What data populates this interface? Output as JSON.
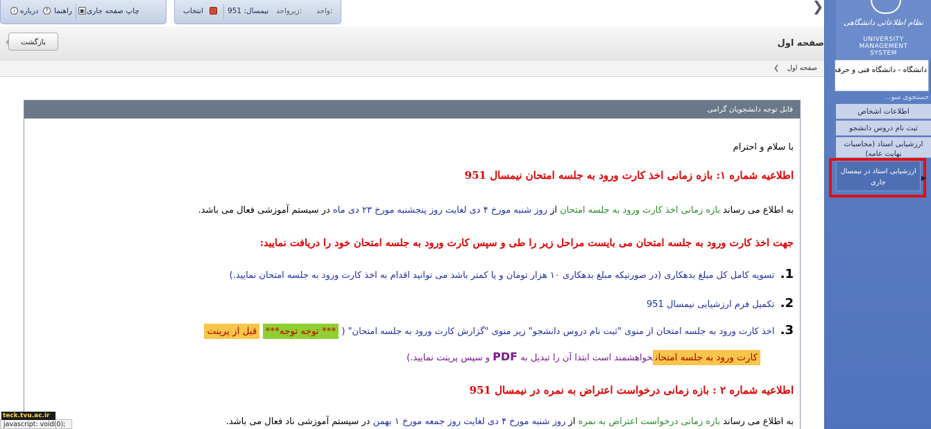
{
  "toolbar": {
    "about": "درباره",
    "help": "راهنما",
    "print_page": "چاپ صفحه جاری",
    "select": "انتخاب",
    "term": "نیمسال: 951",
    "subunit": "زیرواحد:",
    "unit": "واحد:"
  },
  "header": {
    "back": "بازگشت",
    "title": "صفحه اول"
  },
  "breadcrumb": {
    "current": "صفحه اول"
  },
  "sidebar": {
    "logo_fa": "نظام اطلاعاتی دانشگاهی",
    "logo_en_line1": "UNIVERSITY",
    "logo_en_line2": "MANAGEMENT",
    "logo_en_line3": "SYSTEM",
    "university": "دانشگاه - دانشگاه فنی و حرفه‌ای",
    "search_placeholder": "جستجوی منو...",
    "items": [
      {
        "label": "اطلاعات اشخاص"
      },
      {
        "label": "ثبت نام دروس دانشجو"
      },
      {
        "label": "ارزشیابی استاد (محاسبات نهایت عامه)"
      }
    ],
    "subitem": "ارزشیابی استاد در نیمسال جاری"
  },
  "notice": {
    "header": "قابل توجه دانشجویان گرامی",
    "greeting": "با سلام و احترام",
    "n1_title": "اطلاعیه شماره ۱: بازه زمانی اخذ کارت ورود به جلسه امتحان نیمسال 951",
    "n1_body_a": "به اطلاع می رساند ",
    "n1_body_b": "بازه زمانی اخذ کارت ورود به جلسه امتحان",
    "n1_body_c": " از ",
    "n1_body_d": "روز شنبه مورخ ۴ دی لغایت روز پنجشنبه مورخ ۲۳ دی ماه",
    "n1_body_e": " در سیستم آموزشی فعال می باشد.",
    "steps_title": "جهت اخذ کارت ورود به جلسه امتحان می بایست مراحل زیر را طی و سپس کارت ورود به جلسه امتحان خود را دریافت نمایید:",
    "step1_num": "1.",
    "step1": "تسویه کامل کل مبلغ بدهکاری (در صورتیکه مبلغ بدهکاری ۱۰ هزار تومان و یا کمتر باشد می توانید اقدام به اخذ کارت ورود به جلسه امتحان نمایید.)",
    "step2_num": "2.",
    "step2": "تکمیل فرم ارزشیابی نیمسال 951",
    "step3_num": "3.",
    "step3_a": "اخذ کارت ورود به جلسه امتحان از منوی \"ثبت نام دروس دانشجو\" زیر منوی \"گزارش کارت  ورود به جلسه امتحان\" (",
    "step3_b": "*** توجه توجه***",
    "step3_c": "قبل از پرینت",
    "step3_d": "کارت ورود به جلسه امتحان",
    "step3_e": "خواهشمند است ابتدا آن را تبدیل به ",
    "step3_pdf": "PDF",
    "step3_f": " و سپس پرینت نمایید.)",
    "n2_title": "اطلاعیه شماره ۲ : بازه زمانی درخواست اعتراض به نمره در نیمسال 951",
    "n2_body_a": "به اطلاع می رساند ",
    "n2_body_b": "بازه زمانی درخواست اعتراض به نمره",
    "n2_body_c": " از ",
    "n2_body_d": "روز شنبه مورخ ۴ دی لغایت روز جمعه مورخ ۱ بهمن",
    "n2_body_e": " در سیستم آموزشی ناد فعال می باشد."
  },
  "status": {
    "text": "javascript: void(0);",
    "watermark": "teck.tvu.ac.ir"
  },
  "colors": {
    "sidebar": "#5a7cc2",
    "notice_header": "#6b7889",
    "alert_red": "#e00000",
    "highlight_frame": "#e01010"
  }
}
